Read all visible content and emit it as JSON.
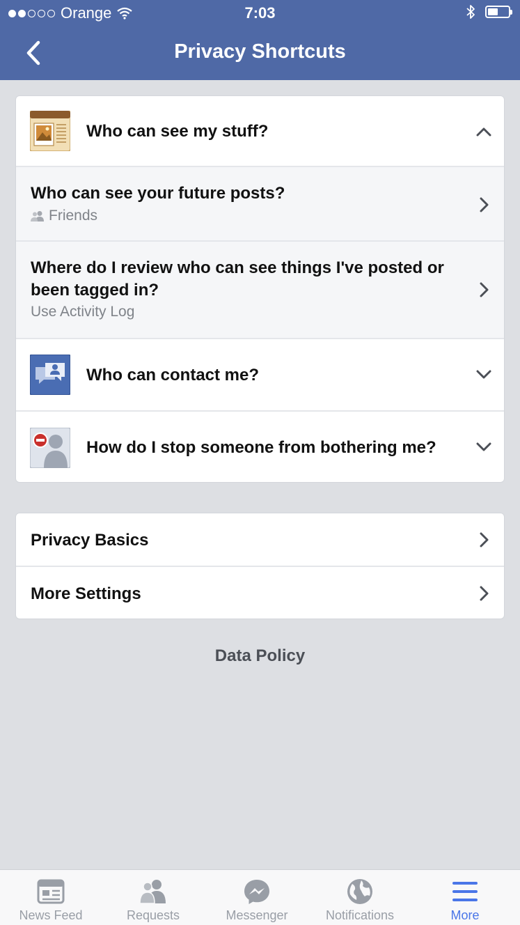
{
  "status_bar": {
    "carrier": "Orange",
    "time": "7:03",
    "signal_bars_filled": 2,
    "signal_bars_total": 5
  },
  "nav": {
    "title": "Privacy Shortcuts",
    "back_icon": "chevron-left-icon"
  },
  "shortcuts": {
    "sections": [
      {
        "title": "Who can see my stuff?",
        "icon": "my-stuff-icon",
        "expanded": true,
        "items": [
          {
            "title": "Who can see your future posts?",
            "meta": "Friends",
            "meta_icon": "friends-icon"
          },
          {
            "title": "Where do I review who can see things I've posted or been tagged in?",
            "meta": "Use Activity Log"
          }
        ]
      },
      {
        "title": "Who can contact me?",
        "icon": "contact-icon",
        "expanded": false
      },
      {
        "title": "How do I stop someone from bothering me?",
        "icon": "block-user-icon",
        "expanded": false
      }
    ]
  },
  "links": {
    "privacy_basics": "Privacy Basics",
    "more_settings": "More Settings"
  },
  "footer": {
    "data_policy": "Data Policy"
  },
  "tab_bar": {
    "tabs": [
      {
        "label": "News Feed",
        "icon": "news-feed-icon"
      },
      {
        "label": "Requests",
        "icon": "requests-icon"
      },
      {
        "label": "Messenger",
        "icon": "messenger-icon"
      },
      {
        "label": "Notifications",
        "icon": "notifications-globe-icon"
      },
      {
        "label": "More",
        "icon": "menu-icon",
        "active": true
      }
    ]
  },
  "colors": {
    "header": "#4f69a6",
    "background": "#dddfe3",
    "active_tab": "#4a76e8",
    "inactive_tab": "#999ea6"
  }
}
